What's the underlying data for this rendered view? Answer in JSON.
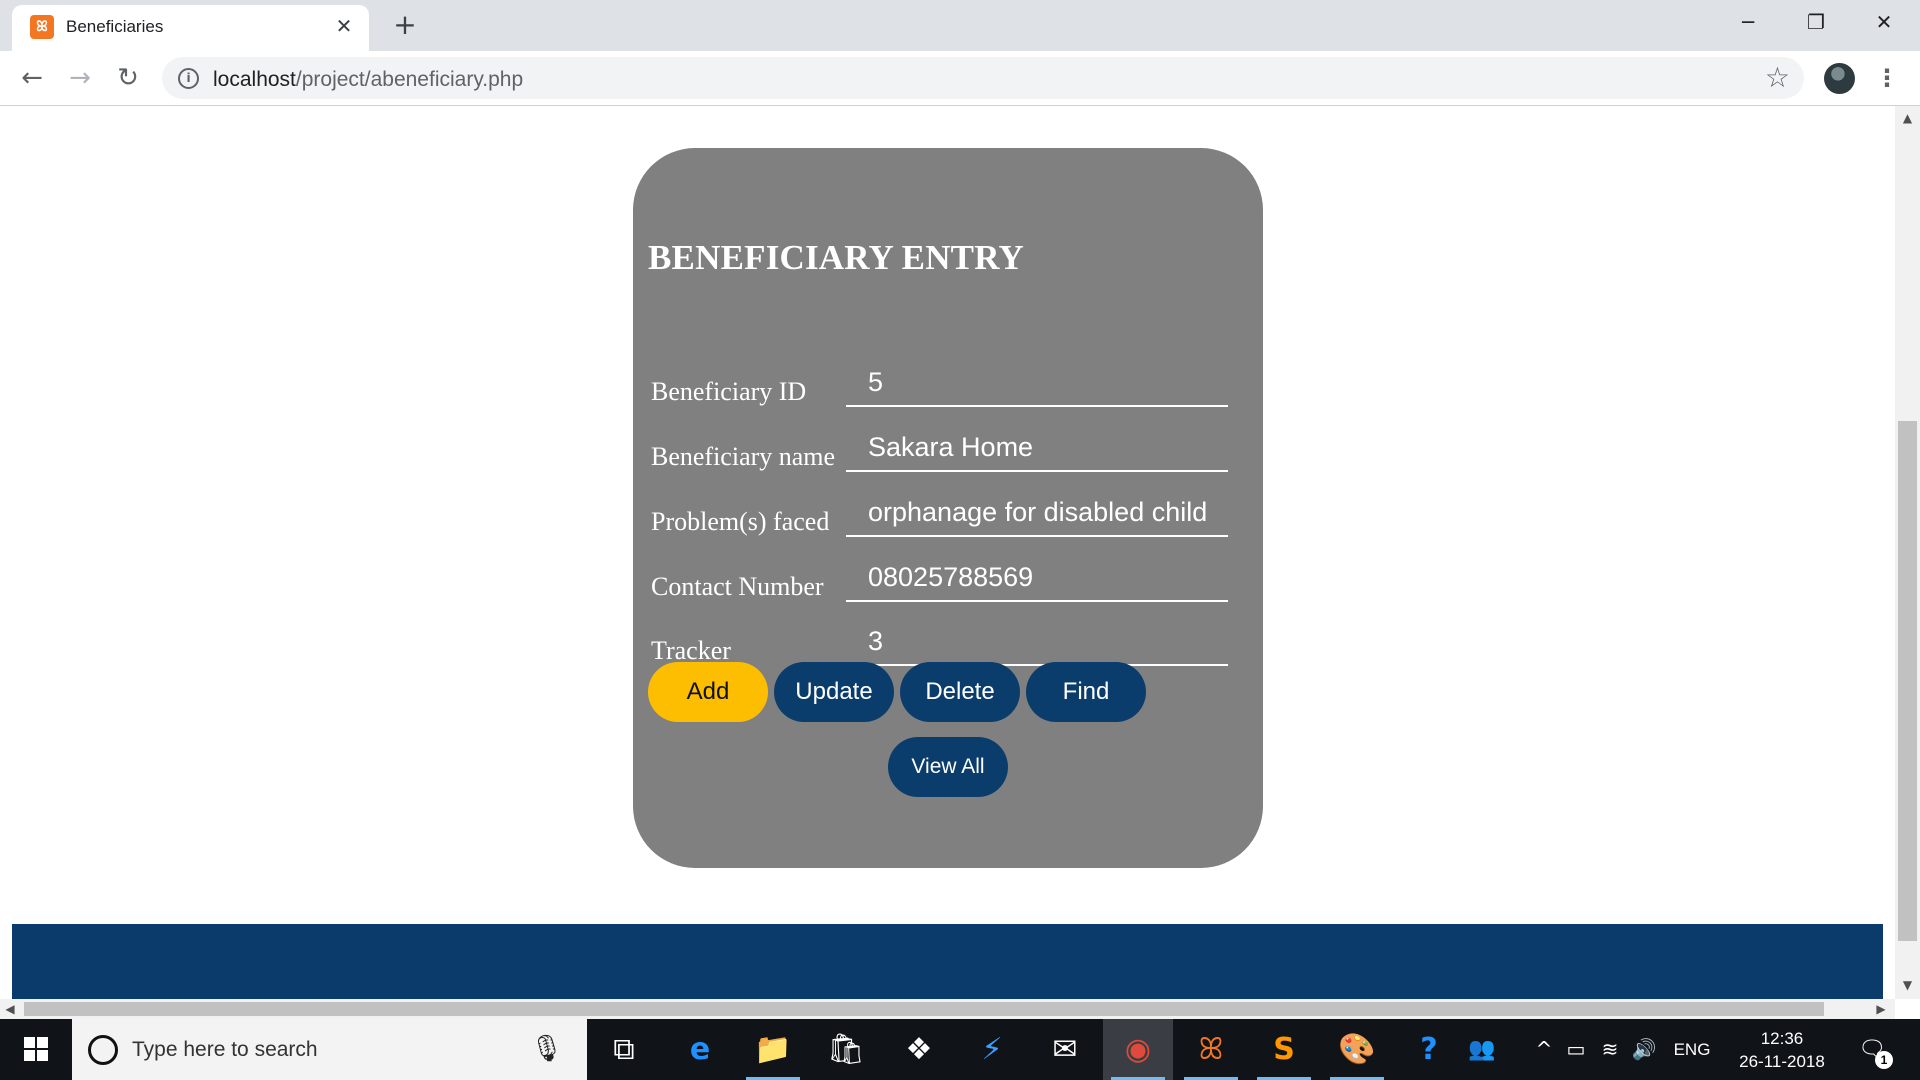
{
  "browser": {
    "tab_title": "Beneficiaries",
    "tab_favicon_glyph": "ꕤ",
    "tab_close_glyph": "✕",
    "new_tab_glyph": "+",
    "window_controls": {
      "minimize": "─",
      "restore": "❐",
      "close": "✕"
    },
    "nav": {
      "back": "←",
      "forward": "→",
      "reload": "↻"
    },
    "url_host": "localhost",
    "url_path": "/project/abeneficiary.php",
    "info_glyph": "i",
    "star_glyph": "☆",
    "menu_glyph": "⋮"
  },
  "form": {
    "heading": "BENEFICIARY ENTRY",
    "fields": [
      {
        "label": "Beneficiary ID",
        "value": "5"
      },
      {
        "label": "Beneficiary name",
        "value": "Sakara Home"
      },
      {
        "label": "Problem(s) faced",
        "value": "orphanage for disabled child"
      },
      {
        "label": "Contact Number",
        "value": "08025788569"
      },
      {
        "label": "Tracker",
        "value": "3"
      }
    ],
    "buttons": {
      "add": "Add",
      "update": "Update",
      "delete": "Delete",
      "find": "Find",
      "view_all": "View All"
    }
  },
  "colors": {
    "card_bg": "#808080",
    "add_button": "#fdbd00",
    "primary_button": "#0a3d6b",
    "footer_band": "#0b3b6a"
  },
  "scrollbar": {
    "up": "▲",
    "down": "▼",
    "left": "◀",
    "right": "▶"
  },
  "taskbar": {
    "search_placeholder": "Type here to search",
    "mic_glyph": "🎙",
    "apps": [
      {
        "name": "task-view",
        "glyph": "⧉"
      },
      {
        "name": "edge",
        "glyph": "e"
      },
      {
        "name": "file-explorer",
        "glyph": "📁"
      },
      {
        "name": "store",
        "glyph": "🛍"
      },
      {
        "name": "dropbox",
        "glyph": "❖"
      },
      {
        "name": "visual-studio",
        "glyph": "⚡"
      },
      {
        "name": "mail",
        "glyph": "✉"
      },
      {
        "name": "chrome",
        "glyph": "◉"
      },
      {
        "name": "xampp",
        "glyph": "ꕤ"
      },
      {
        "name": "sublime-text",
        "glyph": "S"
      },
      {
        "name": "paint",
        "glyph": "🎨"
      },
      {
        "name": "help",
        "glyph": "?"
      },
      {
        "name": "people",
        "glyph": "👥"
      }
    ],
    "tray": {
      "chevron": "^",
      "battery": "▭",
      "wifi": "≋",
      "volume": "🔊",
      "language": "ENG"
    },
    "time": "12:36",
    "date": "26-11-2018",
    "notification_count": "1",
    "notification_glyph": "🗨"
  }
}
